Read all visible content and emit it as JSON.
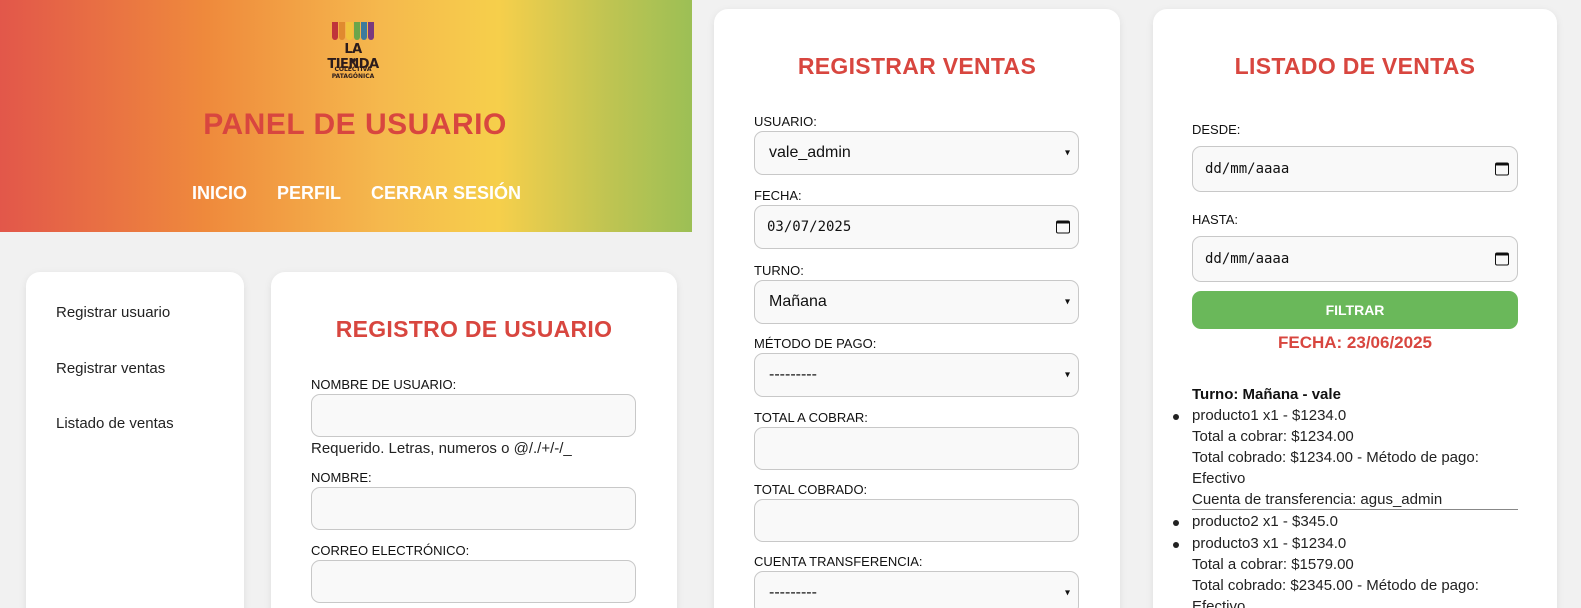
{
  "panel1": {
    "logo": {
      "title": "LA TIENDA",
      "sub1": "COLECTIVA",
      "sub2": "PATAGÓNICA",
      "awning_colors": [
        "#c0343a",
        "#e08a2f",
        "#f1c23c",
        "#6aa64b",
        "#3d7b9c",
        "#7a3a7e"
      ]
    },
    "title": "PANEL DE USUARIO",
    "nav": [
      "INICIO",
      "PERFIL",
      "CERRAR SESIÓN"
    ],
    "sidebar": [
      "Registrar usuario",
      "Registrar ventas",
      "Listado de ventas"
    ],
    "form": {
      "title": "REGISTRO DE USUARIO",
      "username_label": "NOMBRE DE USUARIO:",
      "username_help": "Requerido. Letras, numeros o @/./+/-/_",
      "name_label": "NOMBRE:",
      "email_label": "CORREO ELECTRÓNICO:"
    }
  },
  "panel2": {
    "title": "REGISTRAR VENTAS",
    "usuario_label": "USUARIO:",
    "usuario_value": "vale_admin",
    "fecha_label": "FECHA:",
    "fecha_value": "03/07/2025",
    "turno_label": "TURNO:",
    "turno_value": "Mañana",
    "metodo_label": "MÉTODO DE PAGO:",
    "metodo_value": "---------",
    "total_cobrar_label": "TOTAL A COBRAR:",
    "total_cobrado_label": "TOTAL COBRADO:",
    "cuenta_label": "CUENTA TRANSFERENCIA:",
    "cuenta_value": "---------"
  },
  "panel3": {
    "title": "LISTADO DE VENTAS",
    "desde_label": "DESDE:",
    "desde_placeholder": "dd/mm/aaaa",
    "hasta_label": "HASTA:",
    "hasta_placeholder": "dd/mm/aaaa",
    "filter_label": "FILTRAR",
    "fecha": "FECHA: 23/06/2025",
    "turno": "Turno: Mañana - vale",
    "lines": [
      "producto1 x1 - $1234.0",
      "Total a cobrar: $1234.00",
      "Total cobrado: $1234.00 - Método de pago:",
      "Efectivo",
      "Cuenta de transferencia: agus_admin",
      "producto2 x1 - $345.0",
      "producto3 x1 - $1234.0",
      "Total a cobrar: $1579.00",
      "Total cobrado: $2345.00 - Método de pago:",
      "Efectivo"
    ]
  }
}
